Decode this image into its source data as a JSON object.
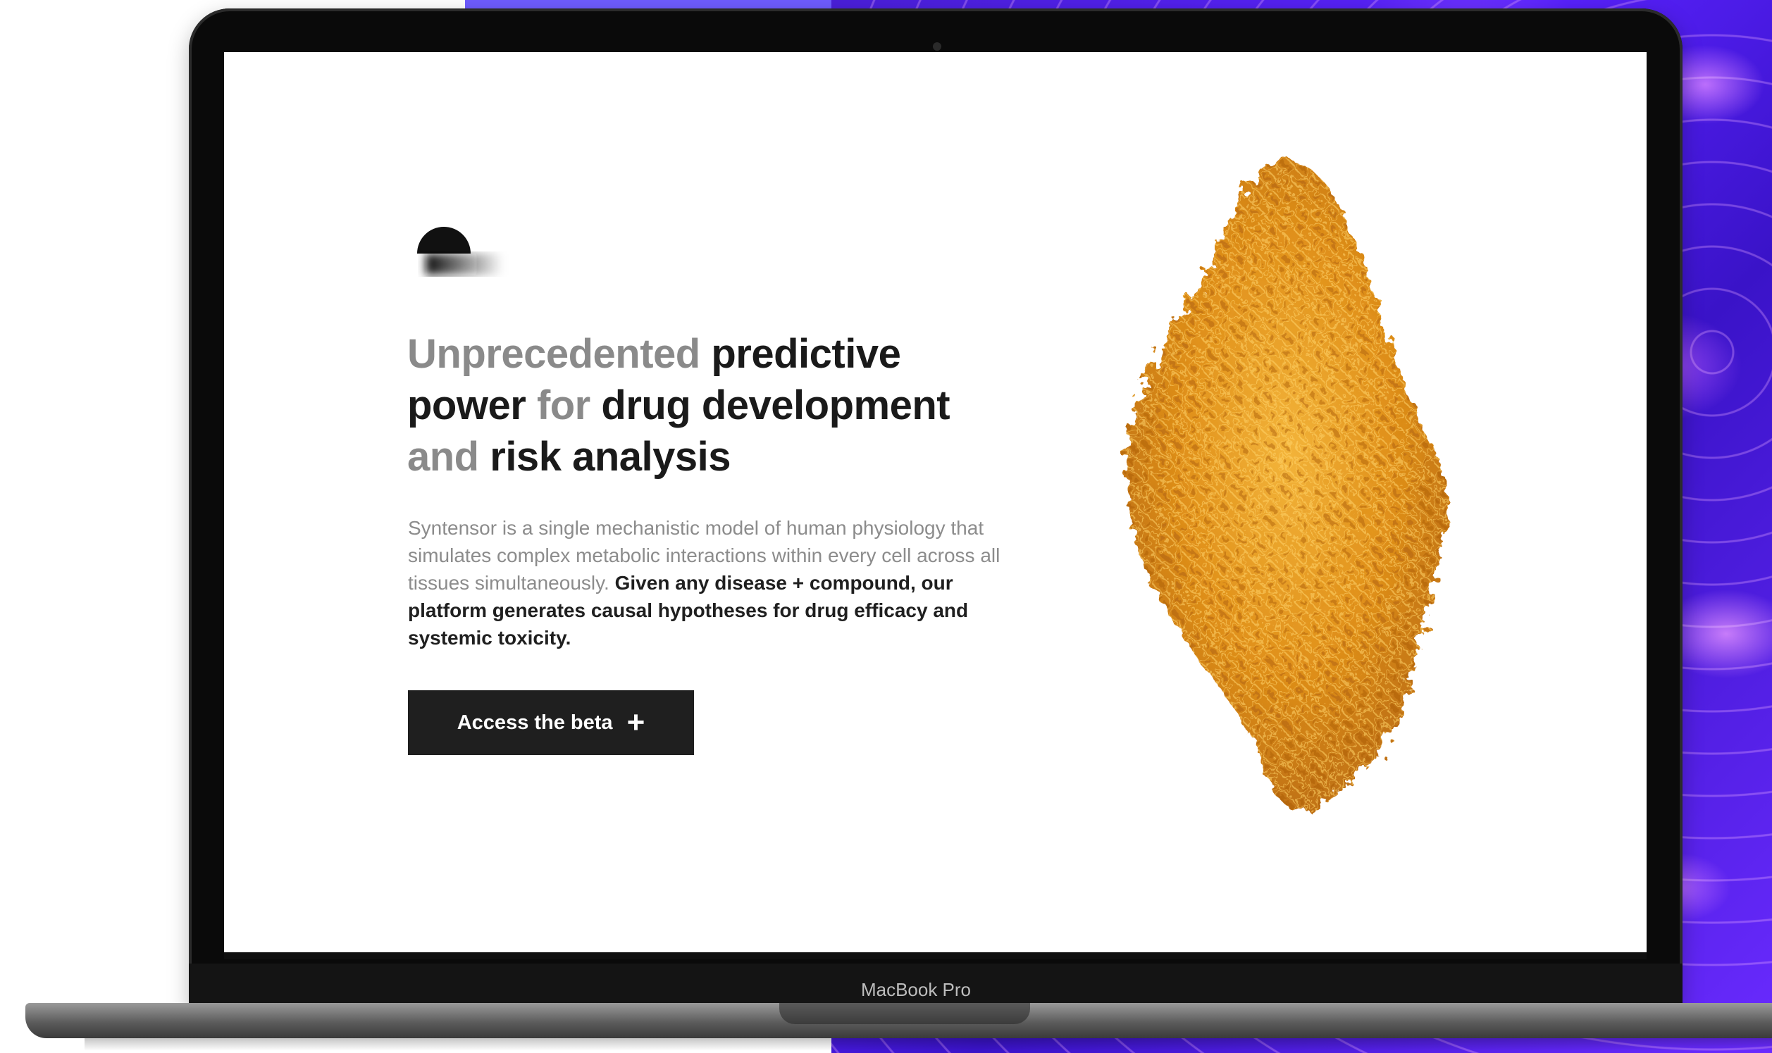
{
  "headline": {
    "line1_muted": "Unprecedented",
    "line1_bold": "predictive",
    "line2_bold_a": "power",
    "line2_muted": "for",
    "line2_bold_b": "drug development",
    "line3_muted": "and",
    "line3_bold": "risk analysis"
  },
  "description": {
    "muted": "Syntensor is a single mechanistic model of human physiology that simulates complex metabolic interactions within every cell across all tissues simultaneously.",
    "strong": "Given any disease + compound, our platform generates causal hypotheses for drug efficacy and systemic toxicity."
  },
  "cta": {
    "label": "Access the beta",
    "icon": "plus-icon",
    "icon_glyph": "+"
  },
  "device": {
    "model_label": "MacBook Pro"
  },
  "colors": {
    "accent_dark": "#1f1f1f",
    "muted_text": "#8a8a8a",
    "molecule_orange": "#e89a1c",
    "background_purple": "#5a22ff"
  }
}
